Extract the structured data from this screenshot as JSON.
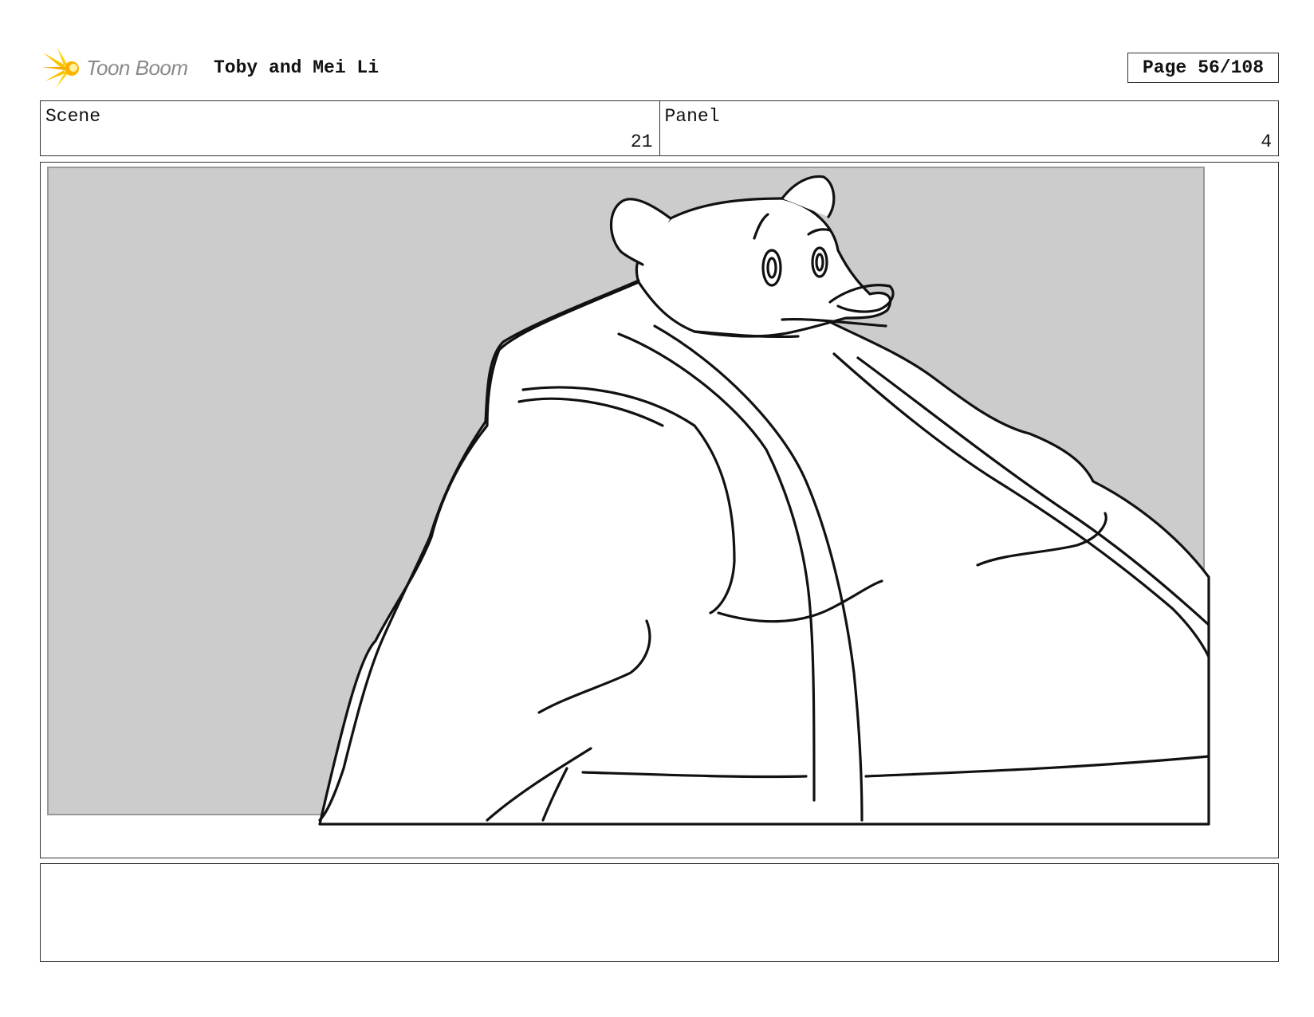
{
  "header": {
    "logo_text": "Toon Boom",
    "logo_icon": "toon-boom-starburst-logo",
    "project_title": "Toby and Mei Li",
    "page_label": "Page",
    "page_value": "56/108"
  },
  "info": {
    "scene_label": "Scene",
    "scene_value": "21",
    "panel_label": "Panel",
    "panel_value": "4"
  },
  "panel": {
    "image": "storyboard-sketch-bear-looking-back-over-shoulder",
    "background_color": "#cccccc",
    "line_color": "#111111"
  },
  "notes": {
    "text": ""
  }
}
